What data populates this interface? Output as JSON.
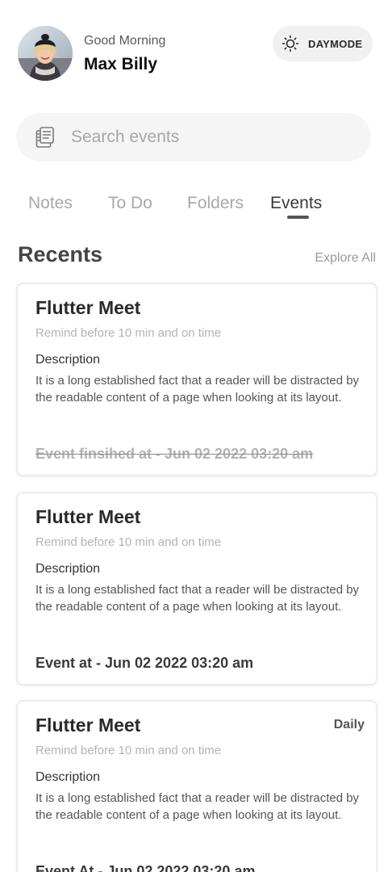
{
  "header": {
    "greeting": "Good Morning",
    "username": "Max Billy",
    "mode_label": "DAYMODE"
  },
  "search": {
    "placeholder": "Search events"
  },
  "tabs": [
    {
      "label": "Notes",
      "active": false
    },
    {
      "label": "To Do",
      "active": false
    },
    {
      "label": "Folders",
      "active": false
    },
    {
      "label": "Events",
      "active": true
    }
  ],
  "recents": {
    "title": "Recents",
    "explore_label": "Explore All"
  },
  "cards": [
    {
      "title": "Flutter Meet",
      "remind": "Remind before 10 min and on time",
      "desc_label": "Description",
      "desc": "It is a long established fact that a reader will be distracted by the readable content of a page when looking at its layout.",
      "when": "Event finsihed at - Jun 02 2022 03:20 am",
      "finished": true,
      "badge": ""
    },
    {
      "title": "Flutter Meet",
      "remind": "Remind before 10 min and on time",
      "desc_label": "Description",
      "desc": "It is a long established fact that a reader will be distracted by the readable content of a page when looking at its layout.",
      "when": "Event at - Jun 02 2022 03:20 am",
      "finished": false,
      "badge": ""
    },
    {
      "title": "Flutter Meet",
      "remind": "Remind before 10 min and on time",
      "desc_label": "Description",
      "desc": "It is a long established fact that a reader will be distracted by the readable content of a page when looking at its layout.",
      "when": "Event At - Jun 02 2022 03:20 am",
      "finished": false,
      "badge": "Daily"
    }
  ],
  "icons": {
    "mode": "sun-icon",
    "search": "notes-stack-icon"
  }
}
